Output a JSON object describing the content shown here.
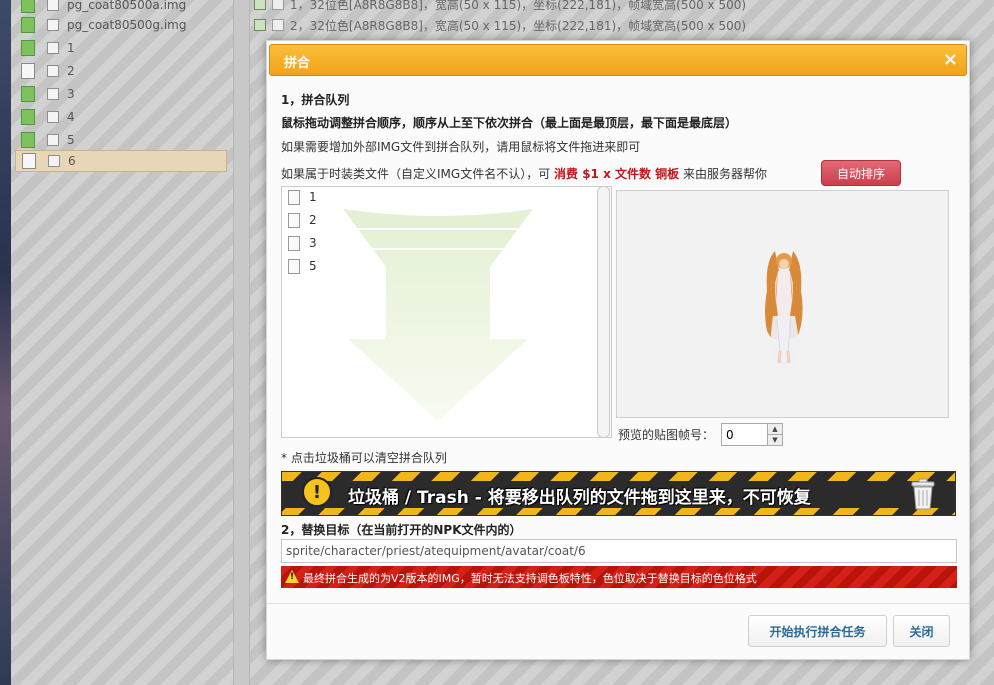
{
  "file_list": {
    "items": [
      {
        "name": "pg_coat80500a.img",
        "icon": "green"
      },
      {
        "name": "pg_coat80500g.img",
        "icon": "green"
      },
      {
        "name": "1",
        "icon": "green"
      },
      {
        "name": "2",
        "icon": "white"
      },
      {
        "name": "3",
        "icon": "green"
      },
      {
        "name": "4",
        "icon": "green"
      },
      {
        "name": "5",
        "icon": "green"
      },
      {
        "name": "6",
        "icon": "white",
        "selected": true
      }
    ]
  },
  "background_rows": [
    "1，32位色[A8R8G8B8]，宽高(50 x 115)，坐标(222,181)，帧域宽高(500 x 500)",
    "2，32位色[A8R8G8B8]，宽高(50 x 115)，坐标(222,181)，帧域宽高(500 x 500)"
  ],
  "modal": {
    "title": "拼合",
    "close_symbol": "×",
    "section1_title": "1，拼合队列",
    "drag_instruction": "鼠标拖动调整拼合顺序，顺序从上至下依次拼合（最上面是最顶层，最下面是最底层）",
    "external_hint": "如果需要增加外部IMG文件到拼合队列，请用鼠标将文件拖进来即可",
    "fashion_hint_prefix": "如果属于时装类文件（自定义IMG文件名不认），可",
    "fashion_hint_cost": "消费 $1 x 文件数 铜板",
    "fashion_hint_suffix": "来由服务器帮你",
    "auto_sort_label": "自动排序",
    "queue_items": [
      "1",
      "2",
      "3",
      "5"
    ],
    "frame_label": "预览的贴图帧号：",
    "frame_value": "0",
    "trash_hint": "* 点击垃圾桶可以清空拼合队列",
    "trash_banner_text": "垃圾桶 / Trash  - 将要移出队列的文件拖到这里来，不可恢复",
    "section2_title": "2，替换目标（在当前打开的NPK文件内的）",
    "target_path": "sprite/character/priest/atequipment/avatar/coat/6",
    "v2_warning": "最终拼合生成的为V2版本的IMG，暂时无法支持调色板特性，色位取决于替换目标的色位格式",
    "start_button": "开始执行拼合任务",
    "close_button": "关闭"
  },
  "colors": {
    "header_orange": "#f3a21c",
    "auto_sort_red": "#cc3e4c",
    "cost_red": "#c0161c",
    "button_text_blue": "#2a6a9a"
  }
}
